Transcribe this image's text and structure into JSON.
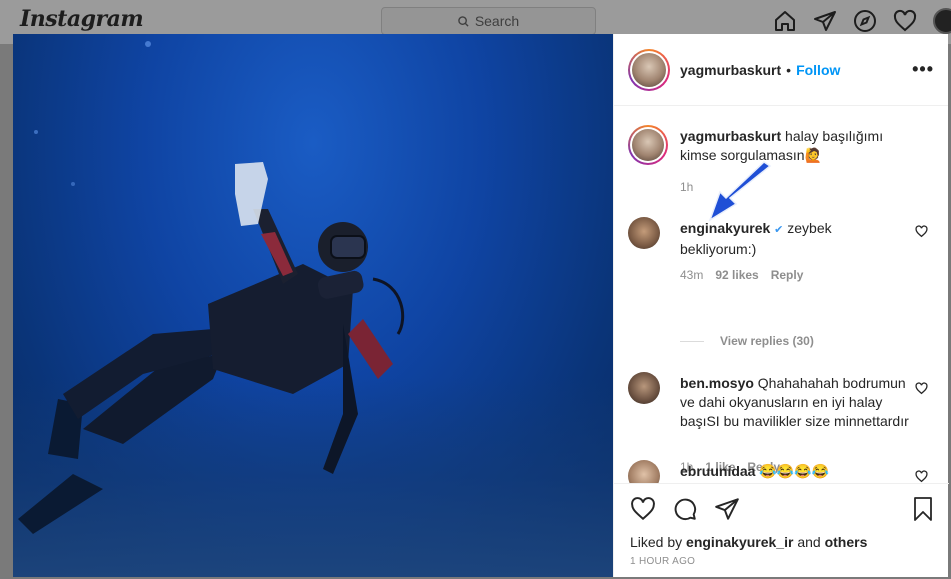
{
  "navbar": {
    "logo": "Instagram",
    "search_placeholder": "Search",
    "icons": [
      "home-icon",
      "direct-icon",
      "explore-icon",
      "activity-heart-icon",
      "profile-avatar"
    ]
  },
  "post": {
    "username": "yagmurbaskurt",
    "dot": "•",
    "follow_label": "Follow",
    "more_label": "•••"
  },
  "comments": [
    {
      "user": "yagmurbaskurt",
      "text": " halay başılığımı kimse sorgulamasın🙋",
      "time": "1h"
    },
    {
      "user": "enginakyurek",
      "verified": "✔",
      "text": " zeybek bekliyorum:)",
      "time": "43m",
      "likes": "92 likes",
      "reply": "Reply",
      "view_replies": "View replies (30)"
    },
    {
      "user": "ben.mosyo",
      "text": " Qhahahahah bodrumun ve dahi okyanusların en iyi halay başıSI bu mavilikler size minnettardır",
      "time": "1h",
      "likes": "1 like",
      "reply": "Reply"
    },
    {
      "user": "ebruunidaa",
      "text": " 😂😂😂😂"
    }
  ],
  "actions": {
    "icons": [
      "like-heart-icon",
      "comment-icon",
      "share-icon",
      "bookmark-icon"
    ],
    "liked_prefix": "Liked by ",
    "liked_user": "enginakyurek_ir",
    "liked_mid": " and ",
    "liked_others": "others",
    "time_ago": "1 HOUR AGO"
  },
  "colors": {
    "accent": "#0095f6",
    "verified": "#3897f0",
    "annotation_arrow": "#1f4fd6"
  }
}
